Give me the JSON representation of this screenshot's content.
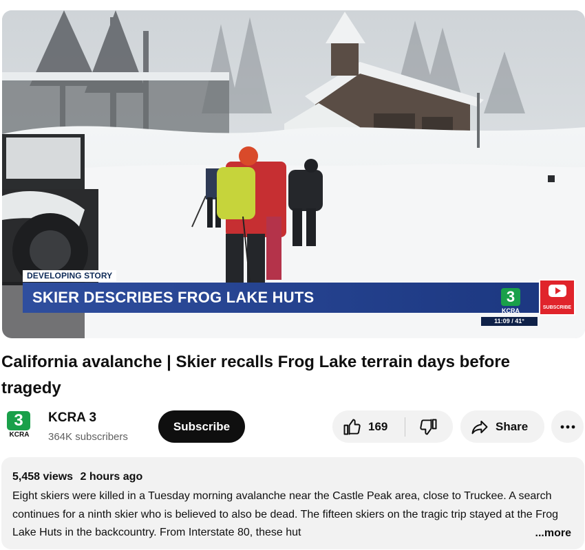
{
  "video": {
    "tag": "DEVELOPING STORY",
    "headline": "SKIER DESCRIBES FROG LAKE HUTS",
    "time_temp": "11:09 / 41°",
    "station_number": "3",
    "station_label": "KCRA",
    "subscribe_overlay": "SUBSCRIBE"
  },
  "title": "California avalanche | Skier recalls Frog Lake terrain days before tragedy",
  "channel": {
    "logo_number": "3",
    "logo_label": "KCRA",
    "name": "KCRA 3",
    "subscribers": "364K subscribers"
  },
  "actions": {
    "subscribe_label": "Subscribe",
    "like_count": "169",
    "share_label": "Share"
  },
  "description": {
    "views": "5,458 views",
    "age": "2 hours ago",
    "text": "Eight skiers were killed in a Tuesday morning avalanche near the Castle Peak area, close to Truckee. A search continues for a ninth skier who is believed to also be dead.  The fifteen skiers on the tragic trip stayed at the Frog Lake Huts in the backcountry. From Interstate 80, these hut",
    "more_label": "...more"
  },
  "colors": {
    "accent": "#0f0f0f",
    "chip_bg": "#f2f2f2",
    "kcra_green": "#1aa04a",
    "news_blue": "#23408c",
    "subscribe_red": "#e0242b"
  }
}
